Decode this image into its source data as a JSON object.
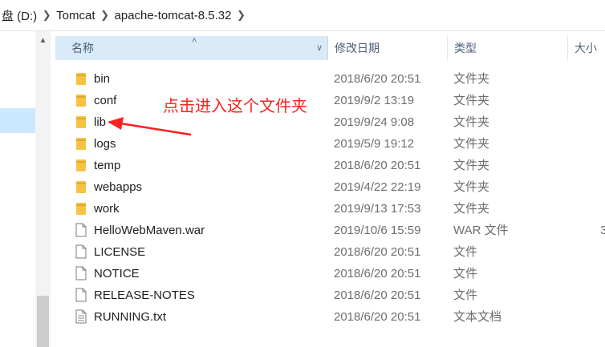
{
  "breadcrumb": {
    "drive": "盘 (D:)",
    "folder1": "Tomcat",
    "folder2": "apache-tomcat-8.5.32"
  },
  "columns": {
    "name": "名称",
    "date": "修改日期",
    "type": "类型",
    "size": "大小"
  },
  "files": [
    {
      "name": "bin",
      "date": "2018/6/20 20:51",
      "type": "文件夹",
      "size": "",
      "icon": "folder"
    },
    {
      "name": "conf",
      "date": "2019/9/2 13:19",
      "type": "文件夹",
      "size": "",
      "icon": "folder"
    },
    {
      "name": "lib",
      "date": "2019/9/24 9:08",
      "type": "文件夹",
      "size": "",
      "icon": "folder"
    },
    {
      "name": "logs",
      "date": "2019/5/9 19:12",
      "type": "文件夹",
      "size": "",
      "icon": "folder"
    },
    {
      "name": "temp",
      "date": "2018/6/20 20:51",
      "type": "文件夹",
      "size": "",
      "icon": "folder"
    },
    {
      "name": "webapps",
      "date": "2019/4/22 22:19",
      "type": "文件夹",
      "size": "",
      "icon": "folder"
    },
    {
      "name": "work",
      "date": "2019/9/13 17:53",
      "type": "文件夹",
      "size": "",
      "icon": "folder"
    },
    {
      "name": "HelloWebMaven.war",
      "date": "2019/10/6 15:59",
      "type": "WAR 文件",
      "size": "3",
      "icon": "file"
    },
    {
      "name": "LICENSE",
      "date": "2018/6/20 20:51",
      "type": "文件",
      "size": "",
      "icon": "file"
    },
    {
      "name": "NOTICE",
      "date": "2018/6/20 20:51",
      "type": "文件",
      "size": "",
      "icon": "file"
    },
    {
      "name": "RELEASE-NOTES",
      "date": "2018/6/20 20:51",
      "type": "文件",
      "size": "",
      "icon": "file"
    },
    {
      "name": "RUNNING.txt",
      "date": "2018/6/20 20:51",
      "type": "文本文档",
      "size": "",
      "icon": "text-file"
    }
  ],
  "annotation": {
    "text": "点击进入这个文件夹",
    "color": "#ff2020"
  },
  "colors": {
    "folder": "#f6c342",
    "header_highlight": "#d9ebf9",
    "nav_selected": "#cce8ff"
  }
}
